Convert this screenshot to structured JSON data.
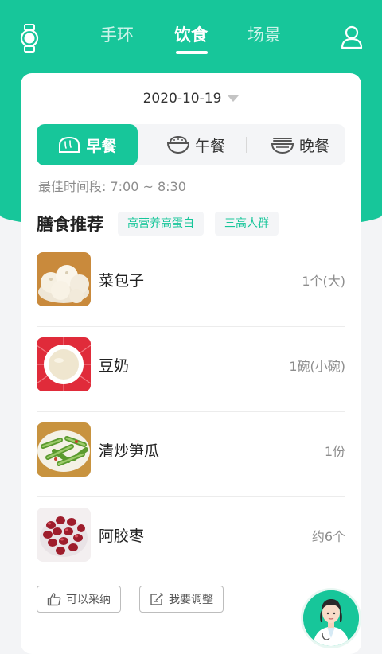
{
  "header": {
    "tabs": [
      {
        "label": "手环"
      },
      {
        "label": "饮食"
      },
      {
        "label": "场景"
      }
    ],
    "active_tab": "饮食"
  },
  "date": {
    "value": "2020-10-19"
  },
  "meals": {
    "tabs": [
      {
        "label": "早餐"
      },
      {
        "label": "午餐"
      },
      {
        "label": "晚餐"
      }
    ],
    "active": "早餐"
  },
  "best_time": "最佳时间段: 7:00 ~ 8:30",
  "recommend": {
    "title": "膳食推荐",
    "tags": [
      "高营养高蛋白",
      "三高人群"
    ]
  },
  "foods": [
    {
      "name": "菜包子",
      "qty": "1个(大)"
    },
    {
      "name": "豆奶",
      "qty": "1碗(小碗)"
    },
    {
      "name": "清炒笋瓜",
      "qty": "1份"
    },
    {
      "name": "阿胶枣",
      "qty": "约6个"
    }
  ],
  "actions": {
    "accept": "可以采纳",
    "adjust": "我要调整"
  },
  "colors": {
    "accent": "#17c69a",
    "background": "#f3f4f6",
    "tag_bg": "#f4f5f7"
  }
}
